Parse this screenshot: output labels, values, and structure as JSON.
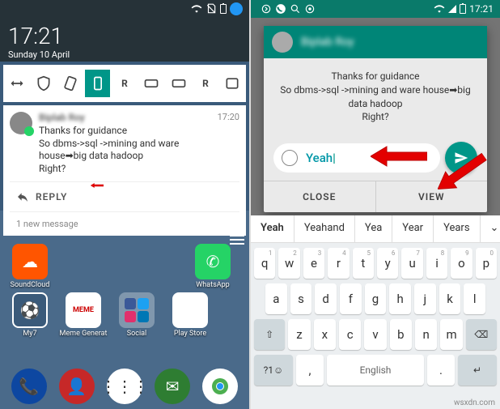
{
  "left": {
    "clock": "17:21",
    "date": "Sunday 10 April",
    "notif": {
      "sender": "Biplab Roy",
      "time": "17:20",
      "line1": "Thanks for guidance",
      "line2": "So dbms->sql ->mining and ware house➡big data hadoop",
      "line3": "Right?",
      "reply": "REPLY",
      "count": "1 new message"
    },
    "apps": [
      "SoundCloud",
      "WhatsApp",
      "My7",
      "Meme Generat",
      "Social",
      "Play Store"
    ]
  },
  "right": {
    "time": "17:21",
    "sender": "Biplab Roy",
    "msgline1": "Thanks for guidance",
    "msgline2": "So dbms->sql ->mining and ware house➡big data hadoop",
    "msgline3": "Right?",
    "input": "Yeah",
    "close": "CLOSE",
    "view": "VIEW",
    "suggestions": [
      "Yeah",
      "Yeahand",
      "Yea",
      "Year",
      "Years"
    ]
  },
  "kbd": {
    "r1": [
      "q",
      "w",
      "e",
      "r",
      "t",
      "y",
      "u",
      "i",
      "o",
      "p"
    ],
    "r1sup": [
      "1",
      "2",
      "3",
      "4",
      "5",
      "6",
      "7",
      "8",
      "9",
      "0"
    ],
    "r2": [
      "a",
      "s",
      "d",
      "f",
      "g",
      "h",
      "j",
      "k",
      "l"
    ],
    "r3": [
      "z",
      "x",
      "c",
      "v",
      "b",
      "n",
      "m"
    ],
    "shift": "⇧",
    "bksp": "⌫",
    "sym": "?1☺",
    "comma": ",",
    "space": "English",
    "dot": ".",
    "enter": "↵"
  },
  "watermark": "wsxdn.com"
}
